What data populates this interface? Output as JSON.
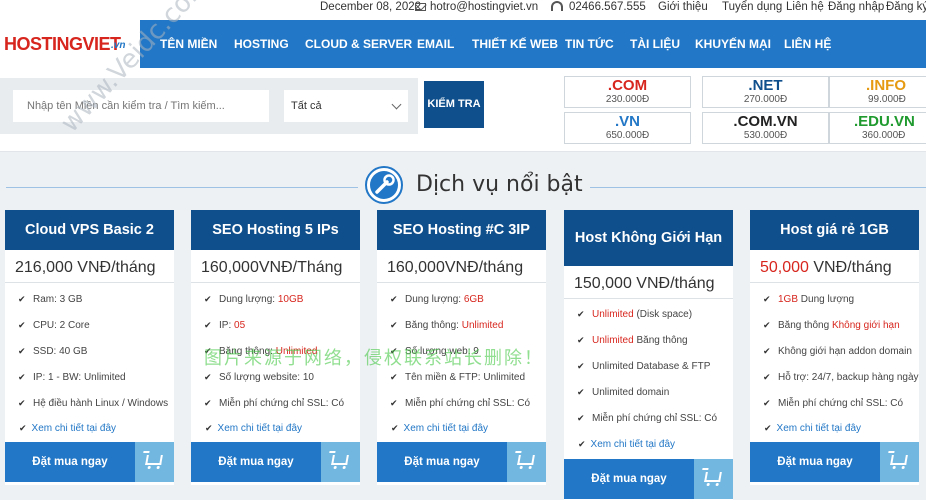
{
  "topbar": {
    "date": "December 08, 2022",
    "email": "hotro@hostingviet.vn",
    "phone": "02466.567.555",
    "links": [
      "Giới thiệu",
      "Tuyển dụng",
      "Liên hệ",
      "Đăng nhập",
      "Đăng ký"
    ]
  },
  "logo": {
    "main": "HOSTINGVIET",
    "suffix": ".vn"
  },
  "nav": [
    "TÊN MIỀN",
    "HOSTING",
    "CLOUD & SERVER",
    "EMAIL",
    "THIẾT KẾ WEB",
    "TIN TỨC",
    "TÀI LIỆU",
    "KHUYẾN MẠI",
    "LIÊN HỆ"
  ],
  "search": {
    "placeholder": "Nhập tên Miền cần kiểm tra / Tìm kiếm...",
    "select_value": "Tất cả",
    "button": "KIỂM TRA"
  },
  "domains": [
    {
      "name": ".COM",
      "price": "230.000Đ",
      "color": "#d7261e"
    },
    {
      "name": ".NET",
      "price": "270.000Đ",
      "color": "#0f4f8c"
    },
    {
      "name": ".INFO",
      "price": "99.000Đ",
      "color": "#e69a12"
    },
    {
      "name": ".VN",
      "price": "650.000Đ",
      "color": "#2277c6"
    },
    {
      "name": ".COM.VN",
      "price": "530.000Đ",
      "color": "#222222"
    },
    {
      "name": ".EDU.VN",
      "price": "360.000Đ",
      "color": "#1f9a2e"
    }
  ],
  "section": {
    "title": "Dịch vụ nổi bật"
  },
  "cards": [
    {
      "title": "Cloud VPS Basic 2",
      "price": "216,000 VNĐ/tháng",
      "features": [
        [
          "Ram: 3 GB"
        ],
        [
          "CPU: 2 Core"
        ],
        [
          "SSD: 40 GB"
        ],
        [
          "IP: 1  -  BW: Unlimited"
        ],
        [
          "Hệ điều hành Linux / Windows"
        ]
      ],
      "more": "Xem chi tiết tại đây",
      "buy": "Đặt mua ngay"
    },
    {
      "title": "SEO Hosting 5 IPs",
      "price": "160,000VNĐ/Tháng",
      "features": [
        [
          "Dung lượng: ",
          "10GB"
        ],
        [
          "IP: ",
          "05"
        ],
        [
          "Băng thông: ",
          "Unlimited"
        ],
        [
          "Số lượng website: 10"
        ],
        [
          "Miễn phí chứng chỉ SSL: Có"
        ]
      ],
      "more": "Xem chi tiết tại đây",
      "buy": "Đặt mua ngay"
    },
    {
      "title": "SEO Hosting #C 3IP",
      "price": "160,000VNĐ/tháng",
      "features": [
        [
          "Dung lượng: ",
          "6GB"
        ],
        [
          "Băng thông: ",
          "Unlimited"
        ],
        [
          "Số lượng web: 9"
        ],
        [
          "Tên miền & FTP: Unlimited"
        ],
        [
          "Miễn phí chứng chỉ SSL: Có"
        ]
      ],
      "more": "Xem chi tiết tại đây",
      "buy": "Đặt mua ngay"
    },
    {
      "title": "Host Không Giới Hạn",
      "price": "150,000 VNĐ/tháng",
      "features": [
        [
          "",
          "Unlimited",
          " (Disk space)"
        ],
        [
          "",
          "Unlimited",
          " Băng thông"
        ],
        [
          "Unlimited Database &  FTP"
        ],
        [
          "Unlimited domain"
        ],
        [
          "Miễn phí chứng chỉ SSL: Có"
        ]
      ],
      "more": "Xem chi tiết tại đây",
      "buy": "Đặt mua ngay"
    },
    {
      "title": "Host giá rẻ 1GB",
      "price_red": "50,000",
      "price_rest": " VNĐ/tháng",
      "features": [
        [
          "",
          "1GB",
          " Dung lượng"
        ],
        [
          "Băng thông ",
          "Không giới hạn"
        ],
        [
          "Không giới hạn addon domain"
        ],
        [
          "Hỗ trợ: 24/7, backup hàng ngày"
        ],
        [
          "Miễn phí chứng chỉ SSL: Có"
        ]
      ],
      "more": "Xem chi tiết tại đây",
      "buy": "Đặt mua ngay"
    }
  ],
  "watermarks": {
    "diagonal": "www.Veidc.com",
    "chinese": "图片来源于网络，侵权联系站长删除！"
  }
}
